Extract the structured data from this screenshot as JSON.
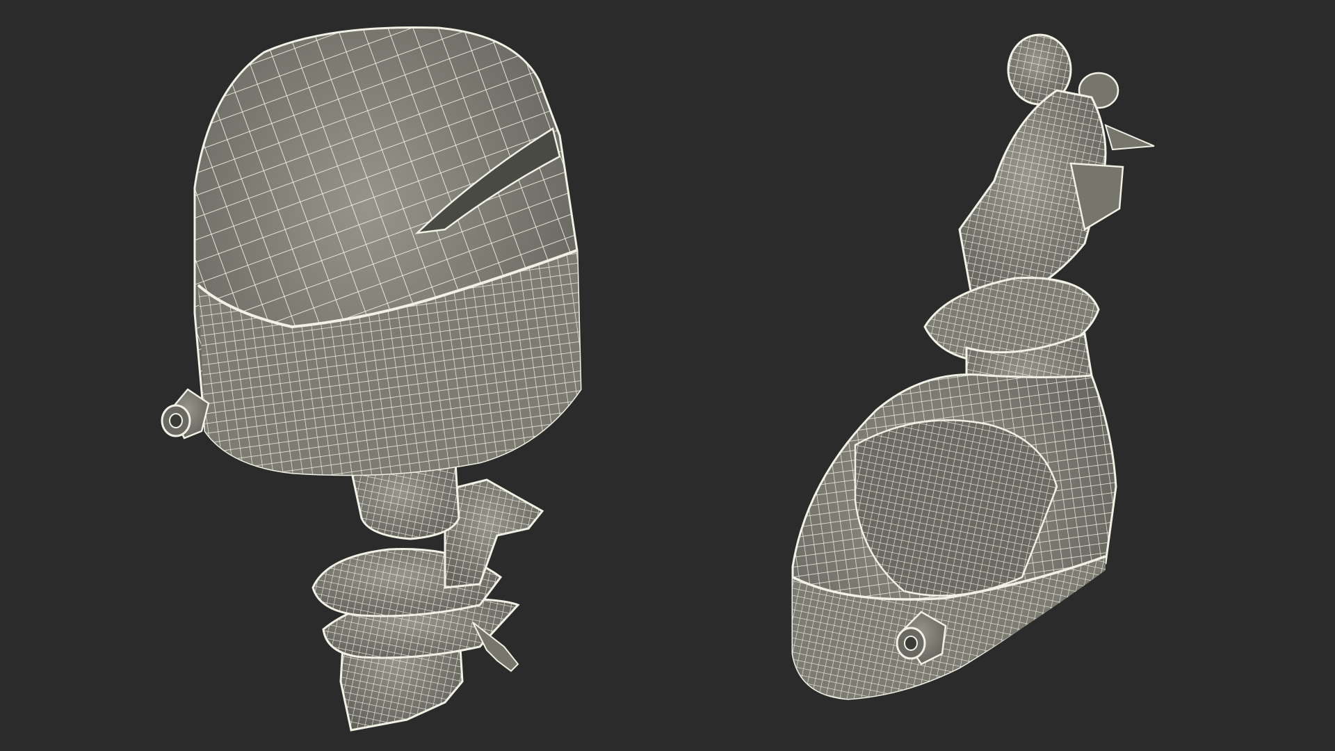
{
  "viewport": {
    "background": "#2b2b2b",
    "mesh_fill": "#8a8a80",
    "mesh_shade": "#6f6f66",
    "wire_color": "#f2f1e6"
  },
  "models": [
    {
      "name": "outboard-motor-front-view",
      "wireframe": true
    },
    {
      "name": "outboard-motor-rear-view",
      "wireframe": true
    }
  ]
}
